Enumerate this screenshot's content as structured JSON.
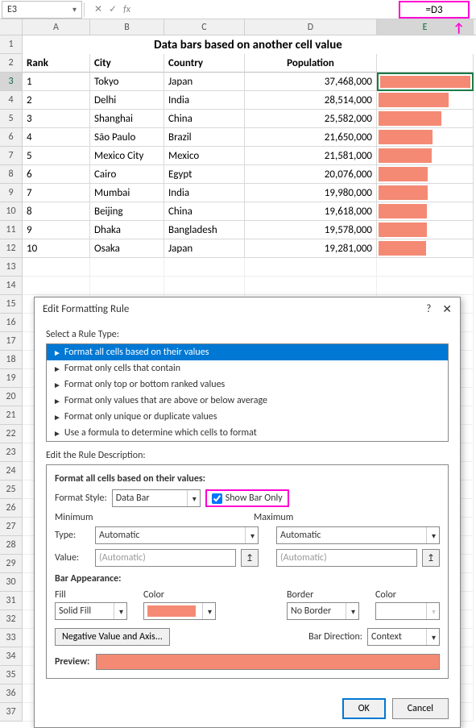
{
  "nameBox": "E3",
  "formula": "=D3",
  "columns": [
    "A",
    "B",
    "C",
    "D",
    "E"
  ],
  "title": "Data bars based on another cell value",
  "headers": {
    "rank": "Rank",
    "city": "City",
    "country": "Country",
    "pop": "Population"
  },
  "rows": [
    {
      "n": "1",
      "rank": "1",
      "city": "Tokyo",
      "country": "Japan",
      "pop": "37,468,000",
      "bar": 100
    },
    {
      "n": "2",
      "rank": "2",
      "city": "Delhi",
      "country": "India",
      "pop": "28,514,000",
      "bar": 76
    },
    {
      "n": "3",
      "rank": "3",
      "city": "Shanghai",
      "country": "China",
      "pop": "25,582,000",
      "bar": 68
    },
    {
      "n": "4",
      "rank": "4",
      "city": "São Paulo",
      "country": "Brazil",
      "pop": "21,650,000",
      "bar": 58
    },
    {
      "n": "5",
      "rank": "5",
      "city": "Mexico City",
      "country": "Mexico",
      "pop": "21,581,000",
      "bar": 57
    },
    {
      "n": "6",
      "rank": "6",
      "city": "Cairo",
      "country": "Egypt",
      "pop": "20,076,000",
      "bar": 53
    },
    {
      "n": "7",
      "rank": "7",
      "city": "Mumbai",
      "country": "India",
      "pop": "19,980,000",
      "bar": 53
    },
    {
      "n": "8",
      "rank": "8",
      "city": "Beijing",
      "country": "China",
      "pop": "19,618,000",
      "bar": 52
    },
    {
      "n": "9",
      "rank": "9",
      "city": "Dhaka",
      "country": "Bangladesh",
      "pop": "19,578,000",
      "bar": 52
    },
    {
      "n": "10",
      "rank": "10",
      "city": "Osaka",
      "country": "Japan",
      "pop": "19,281,000",
      "bar": 51
    }
  ],
  "dialog": {
    "title": "Edit Formatting Rule",
    "selectLabel": "Select a Rule Type:",
    "rules": [
      "Format all cells based on their values",
      "Format only cells that contain",
      "Format only top or bottom ranked values",
      "Format only values that are above or below average",
      "Format only unique or duplicate values",
      "Use a formula to determine which cells to format"
    ],
    "editLabel": "Edit the Rule Description:",
    "descHeading": "Format all cells based on their values:",
    "formatStyle": {
      "label": "Format Style:",
      "value": "Data Bar"
    },
    "showBarOnly": "Show Bar Only",
    "minimum": "Minimum",
    "maximum": "Maximum",
    "typeLabel": "Type:",
    "valueLabel": "Value:",
    "autoType": "Automatic",
    "autoVal": "(Automatic)",
    "barAppearance": "Bar Appearance:",
    "fill": "Fill",
    "color": "Color",
    "border": "Border",
    "fillValue": "Solid Fill",
    "borderValue": "No Border",
    "negBtn": "Negative Value and Axis...",
    "barDir": "Bar Direction:",
    "barDirVal": "Context",
    "preview": "Preview:",
    "ok": "OK",
    "cancel": "Cancel"
  },
  "chart_data": {
    "type": "bar",
    "title": "Data bars based on another cell value",
    "categories": [
      "Tokyo",
      "Delhi",
      "Shanghai",
      "São Paulo",
      "Mexico City",
      "Cairo",
      "Mumbai",
      "Beijing",
      "Dhaka",
      "Osaka"
    ],
    "values": [
      37468000,
      28514000,
      25582000,
      21650000,
      21581000,
      20076000,
      19980000,
      19618000,
      19578000,
      19281000
    ],
    "xlabel": "",
    "ylabel": "Population",
    "ylim": [
      0,
      37468000
    ]
  }
}
